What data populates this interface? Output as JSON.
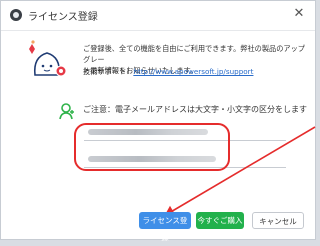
{
  "window": {
    "title": "ライセンス登録",
    "close_glyph": "✕"
  },
  "intro": {
    "line1": "ご登録後、全ての機能を自由にご利用できます。弊社の製品のアップグレー",
    "line2": "ト最新情報をお知らせいたします。",
    "support_label": "技術サポート：",
    "support_url": "http://www.apowersoft.jp/support"
  },
  "notice": "ご注意：電子メールアドレスは大文字・小文字の区分をします",
  "fields": {
    "email_value_blurred": true,
    "code_value_blurred": true
  },
  "buttons": {
    "register": "ライセンス登録",
    "buy": "今すぐご購入",
    "cancel": "キャンセル"
  },
  "colors": {
    "annotation_red": "#e52c2c",
    "register_button": "#3f8fe8",
    "buy_button": "#22b14c",
    "link": "#2a6cc9"
  }
}
